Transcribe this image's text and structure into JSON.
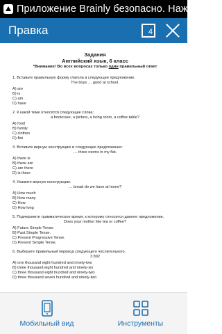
{
  "status_bar": {
    "app_icon": "brainly-icon",
    "notification_text": "Приложение Brainly безопасно. Нажмите,"
  },
  "toolbar": {
    "title": "Правка",
    "tabs_count": "4",
    "close_icon": "close-icon"
  },
  "document": {
    "title": "Задания",
    "subtitle": "Английский язык, 6 класс",
    "warning_prefix": "*Внимание! Во всех вопросах только ",
    "warning_underlined": "один",
    "warning_suffix": " правильный ответ",
    "questions": [
      {
        "text": "1. Вставьте правильную форму глагола в следующее предложение.",
        "sub": "The  boys … good at school.",
        "options": [
          "A) are",
          "B) is",
          "C) am",
          "D) have"
        ]
      },
      {
        "text": "2. К какой теме относятся следующие слова:",
        "sub": "a bookcase,  a picture,  a living room,  a coffee table?",
        "options": [
          "A) food",
          "B) family",
          "C) clothes",
          "D) flat"
        ]
      },
      {
        "text": "3. Вставьте верную конструкцию в следующее предложение:",
        "sub": "… three rooms in my flat.",
        "options": [
          "A) there is",
          "B) there are",
          "C) are there",
          "D) is there"
        ]
      },
      {
        "text": "4. Укажите верную конструкцию.",
        "sub": "… bread do we have at home?",
        "options": [
          "A) How much",
          "B) How many",
          "C) How",
          "D) How long"
        ]
      },
      {
        "text": "5.  Подчеркните  грамматическое  время,  к  которому  относится  данное предложение.",
        "sub": "Does your mother like tea or coffee?",
        "options": [
          "A) Future Simple Tense.",
          "B) Past Simple Tense.",
          "C) Present  Progressive  Tense.",
          "D) Present Simple Tense."
        ]
      },
      {
        "text": "6. Выберите правильный перевод следующего числительного.",
        "sub": "3 892",
        "options": [
          "A) one thousand eight hundred and ninety-two",
          "B) three thousand eight hundred and ninety-six",
          "C) three thousand eight hundred and ninety-two",
          "D) three thousand seven hundred and ninety-two"
        ]
      }
    ]
  },
  "bottom_bar": {
    "mobile_view_label": "Мобильный вид",
    "tools_label": "Инструменты"
  },
  "colors": {
    "toolbar": "#1a6fb0",
    "status_bar": "#000000",
    "accent_text": "#1a6fb0"
  }
}
